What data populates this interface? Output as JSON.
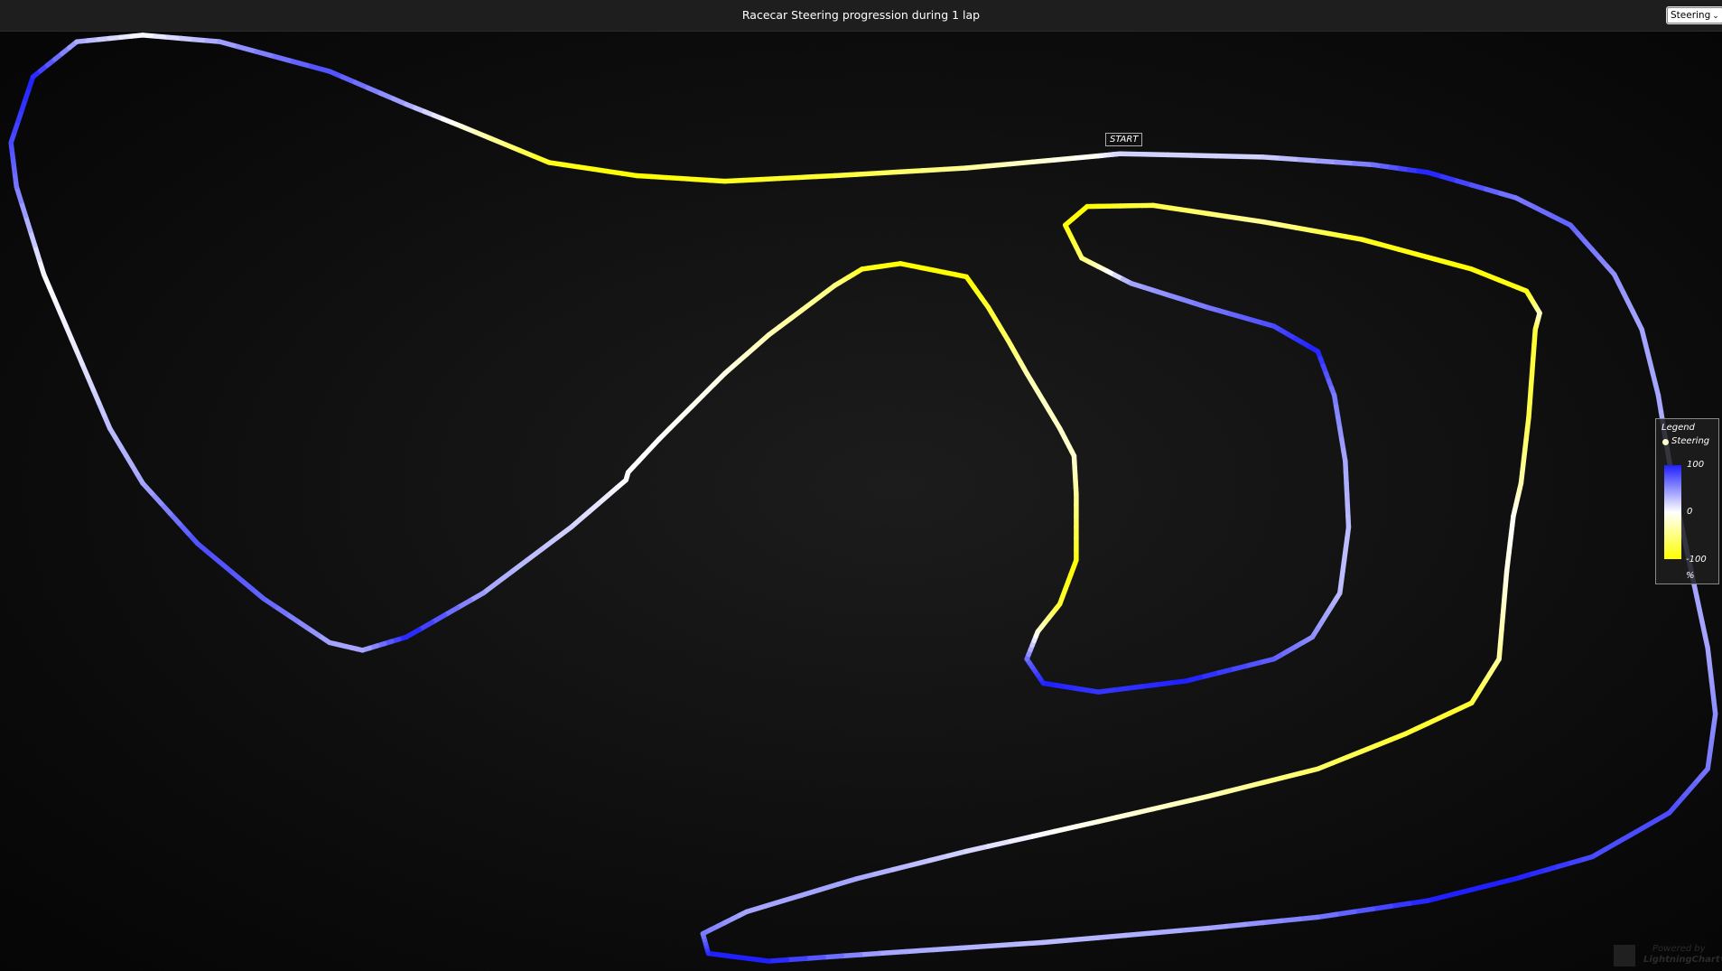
{
  "header": {
    "title": "Racecar Steering progression during 1 lap",
    "dropdown_value": "Steering"
  },
  "start_label": "START",
  "legend": {
    "title": "Legend",
    "series": "Steering",
    "max": "100",
    "mid": "0",
    "min": "-100",
    "unit": "%",
    "colors": {
      "max": "#2020ff",
      "mid": "#ffffff",
      "min": "#ffff00"
    }
  },
  "watermark": {
    "line1": "Powered by",
    "line2": "LightningChart®"
  },
  "chart_data": {
    "type": "line",
    "title": "Racecar Steering progression during 1 lap",
    "series": [
      {
        "name": "Steering",
        "color_scale": {
          "-100": "#ffff00",
          "0": "#ffffff",
          "100": "#2020ff"
        },
        "steering_percent": [
          20,
          20,
          60,
          100,
          60,
          70,
          50,
          40,
          40,
          30,
          40,
          40,
          50,
          60,
          80,
          80,
          100,
          100,
          60,
          40,
          30,
          40,
          100,
          100,
          60,
          40,
          40,
          20,
          -10,
          -30,
          -60,
          -80,
          -80,
          -40,
          -10,
          0,
          -30,
          -70,
          -80,
          -20,
          -90,
          -100,
          -90,
          -40,
          -70,
          -100,
          -100,
          -60,
          40,
          60,
          80,
          100,
          60,
          40,
          30,
          30,
          50,
          70,
          100,
          90,
          100,
          70,
          -10,
          -80,
          -100,
          -40,
          -20,
          -20,
          -30,
          -60,
          -80,
          -100,
          -100,
          -90,
          -50,
          -30,
          -10,
          0,
          0,
          0,
          20,
          40,
          100,
          40,
          40,
          70,
          80,
          40,
          30,
          10,
          0,
          60,
          80,
          100,
          40,
          0,
          40,
          80,
          40,
          -10,
          -90,
          -100,
          -90,
          -80,
          -40,
          0,
          20
        ]
      }
    ],
    "unit": "%"
  }
}
